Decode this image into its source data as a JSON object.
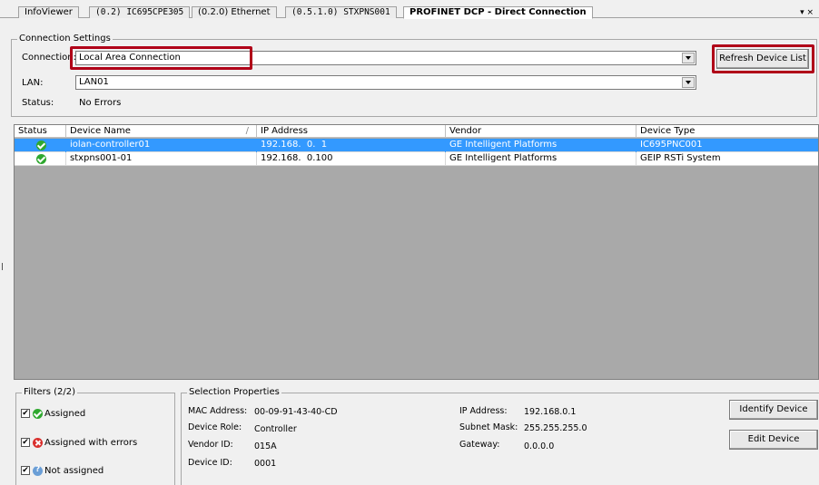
{
  "tabs": [
    {
      "label": "InfoViewer"
    },
    {
      "label": "(0.2) IC695CPE305"
    },
    {
      "label": "(0.2.0) Ethernet"
    },
    {
      "label": "(0.5.1.0) STXPNS001"
    },
    {
      "label": "PROFINET DCP - Direct Connection"
    }
  ],
  "tab_controls": "▾ ×",
  "connection_settings": {
    "title": "Connection Settings",
    "connection_label": "Connection:",
    "connection_value": "Local Area Connection",
    "lan_label": "LAN:",
    "lan_value": "LAN01",
    "status_label": "Status:",
    "status_value": "No Errors",
    "refresh_button": "Refresh Device List"
  },
  "device_table": {
    "columns": [
      "Status",
      "Device Name",
      "IP Address",
      "Vendor",
      "Device Type"
    ],
    "sort_indicator": "/",
    "rows": [
      {
        "status": "ok",
        "device_name": "iolan-controller01",
        "ip_address": "192.168.  0.  1",
        "vendor": "GE Intelligent Platforms",
        "device_type": "IC695PNC001",
        "selected": true
      },
      {
        "status": "ok",
        "device_name": "stxpns001-01",
        "ip_address": "192.168.  0.100",
        "vendor": "GE Intelligent Platforms",
        "device_type": "GEIP RSTi System",
        "selected": false
      }
    ]
  },
  "filters": {
    "title": "Filters (2/2)",
    "items": [
      {
        "label": "Assigned",
        "checked": true,
        "icon": "green-check-icon"
      },
      {
        "label": "Assigned with errors",
        "checked": true,
        "icon": "red-error-icon"
      },
      {
        "label": "Not assigned",
        "checked": true,
        "icon": "blue-question-icon"
      }
    ]
  },
  "selection_properties": {
    "title": "Selection Properties",
    "mac_label": "MAC Address:",
    "mac_value": "00-09-91-43-40-CD",
    "role_label": "Device Role:",
    "role_value": "Controller",
    "vendor_label": "Vendor ID:",
    "vendor_value": "015A",
    "device_label": "Device ID:",
    "device_value": "0001",
    "ip_label": "IP Address:",
    "ip_value": "192.168.0.1",
    "subnet_label": "Subnet Mask:",
    "subnet_value": "255.255.255.0",
    "gateway_label": "Gateway:",
    "gateway_value": "0.0.0.0",
    "identify_button": "Identify Device",
    "edit_button": "Edit Device"
  },
  "colors": {
    "highlight": "#b00018",
    "selection": "#3399ff",
    "grid_empty": "#a9a9a9"
  }
}
